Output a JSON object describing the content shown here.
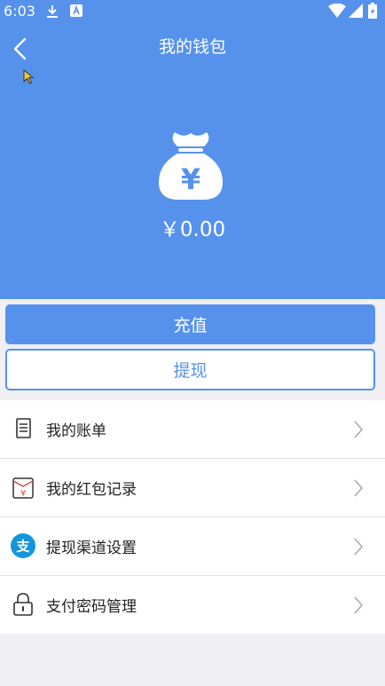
{
  "status_bar": {
    "time": "6:03"
  },
  "header": {
    "title": "我的钱包",
    "balance": "￥0.00",
    "bag_symbol": "¥",
    "background_color": "#5692ec"
  },
  "actions": {
    "recharge_label": "充值",
    "withdraw_label": "提现",
    "accent_color": "#5692ec"
  },
  "menu": {
    "items": [
      {
        "label": "我的账单",
        "icon": "bill-icon"
      },
      {
        "label": "我的红包记录",
        "icon": "red-envelope-icon"
      },
      {
        "label": "提现渠道设置",
        "icon": "alipay-icon"
      },
      {
        "label": "支付密码管理",
        "icon": "lock-icon"
      }
    ]
  },
  "icons": {
    "envelope_symbol": "¥",
    "alipay_symbol": "支"
  }
}
